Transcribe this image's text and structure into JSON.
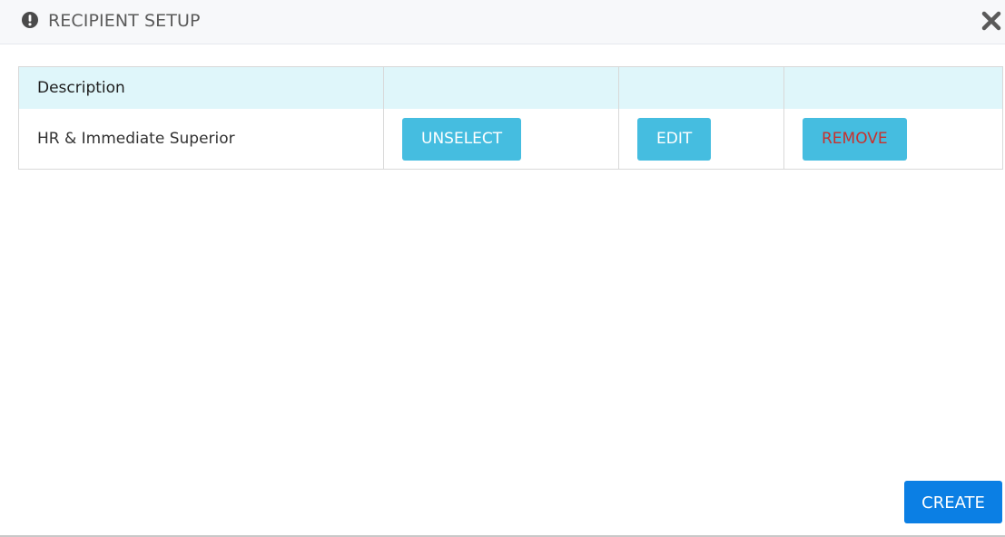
{
  "dialog": {
    "title": "RECIPIENT SETUP",
    "title_icon": "exclamation-circle-icon",
    "close_icon": "close-icon"
  },
  "table": {
    "columns": [
      "Description",
      "",
      "",
      ""
    ],
    "rows": [
      {
        "description": "HR & Immediate Superior",
        "unselect_label": "UNSELECT",
        "edit_label": "EDIT",
        "remove_label": "REMOVE"
      }
    ]
  },
  "footer": {
    "create_label": "CREATE"
  },
  "colors": {
    "header_bg": "#f7f8fa",
    "table_header_bg": "#dff6fa",
    "row_button_bg": "#45bde0",
    "remove_text": "#c9302c",
    "create_bg": "#0b7fe4"
  }
}
